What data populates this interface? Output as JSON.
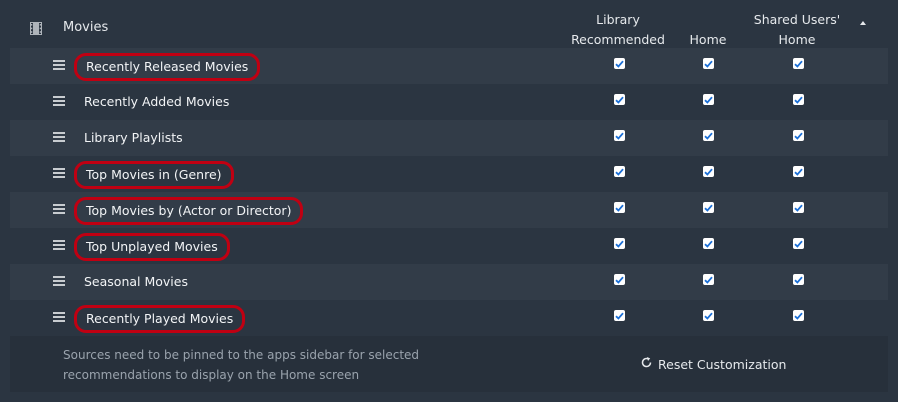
{
  "header": {
    "title": "Movies",
    "columns": [
      "Library Recommended",
      "Home",
      "Shared Users' Home"
    ],
    "column_lines": [
      [
        "Library",
        "Recommended"
      ],
      [
        "",
        "Home"
      ],
      [
        "Shared Users'",
        "Home"
      ]
    ]
  },
  "rows": [
    {
      "label": "Recently Released Movies",
      "highlighted": true,
      "checks": [
        true,
        true,
        true
      ]
    },
    {
      "label": "Recently Added Movies",
      "highlighted": false,
      "checks": [
        true,
        true,
        true
      ]
    },
    {
      "label": "Library Playlists",
      "highlighted": false,
      "checks": [
        true,
        true,
        true
      ]
    },
    {
      "label": "Top Movies in (Genre)",
      "highlighted": true,
      "checks": [
        true,
        true,
        true
      ]
    },
    {
      "label": "Top Movies by (Actor or Director)",
      "highlighted": true,
      "checks": [
        true,
        true,
        true
      ]
    },
    {
      "label": "Top Unplayed Movies",
      "highlighted": true,
      "checks": [
        true,
        true,
        true
      ]
    },
    {
      "label": "Seasonal Movies",
      "highlighted": false,
      "checks": [
        true,
        true,
        true
      ]
    },
    {
      "label": "Recently Played Movies",
      "highlighted": true,
      "checks": [
        true,
        true,
        true
      ]
    }
  ],
  "footer": {
    "note_line1": "Sources need to be pinned to the apps sidebar for selected",
    "note_line2": "recommendations to display on the Home screen",
    "reset_label": "Reset Customization"
  },
  "colors": {
    "background": "#2b3541",
    "row_alt": "#323c48",
    "highlight_ring": "#c00012",
    "checkbox_check": "#1b6fd6"
  },
  "icons": [
    "film-icon",
    "drag-handle-icon",
    "sort-ascending-icon",
    "reset-icon",
    "checkbox-icon"
  ]
}
